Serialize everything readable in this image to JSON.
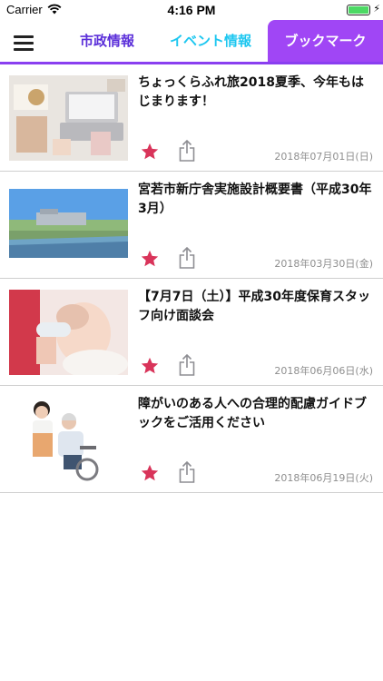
{
  "status_bar": {
    "carrier": "Carrier",
    "time": "4:16 PM"
  },
  "nav": {
    "tabs": [
      {
        "label": "市政情報",
        "color": "#5b2fd9"
      },
      {
        "label": "イベント情報",
        "color": "#1ec7f0"
      },
      {
        "label": "ブックマーク",
        "color": "#ffffff",
        "active": true,
        "background": "#a046f5"
      }
    ],
    "accent": "#8a3ff0"
  },
  "items": [
    {
      "title": "ちょっくらふれ旅2018夏季、今年もはじまります！",
      "date": "2018年07月01日(日)",
      "starred": true
    },
    {
      "title": "宮若市新庁舎実施設計概要書（平成30年3月）",
      "date": "2018年03月30日(金)",
      "starred": true
    },
    {
      "title": "【7月7日（土）】平成30年度保育スタッフ向け面談会",
      "date": "2018年06月06日(水)",
      "starred": true
    },
    {
      "title": "障がいのある人への合理的配慮ガイドブックをご活用ください",
      "date": "2018年06月19日(火)",
      "starred": true
    }
  ],
  "icons": {
    "menu": "hamburger-icon",
    "star": "star-icon",
    "share": "share-icon",
    "star_color": "#d9345a"
  }
}
